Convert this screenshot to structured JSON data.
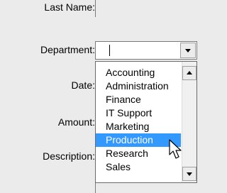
{
  "form": {
    "last_name_label": "Last Name:",
    "department_label": "Department:",
    "date_label": "Date:",
    "amount_label": "Amount:",
    "description_label": "Description:"
  },
  "department_combo": {
    "value": "",
    "options": [
      "Accounting",
      "Administration",
      "Finance",
      "IT Support",
      "Marketing",
      "Production",
      "Research",
      "Sales"
    ],
    "highlighted": "Production"
  },
  "icons": {
    "combo_button": "chevron-down-icon",
    "scroll_up": "scroll-up-arrow-icon",
    "scroll_down": "scroll-down-arrow-icon",
    "cursor": "mouse-pointer-icon"
  },
  "colors": {
    "background": "#ebebeb",
    "selection": "#3399ff",
    "selection_text": "#ffffff"
  }
}
